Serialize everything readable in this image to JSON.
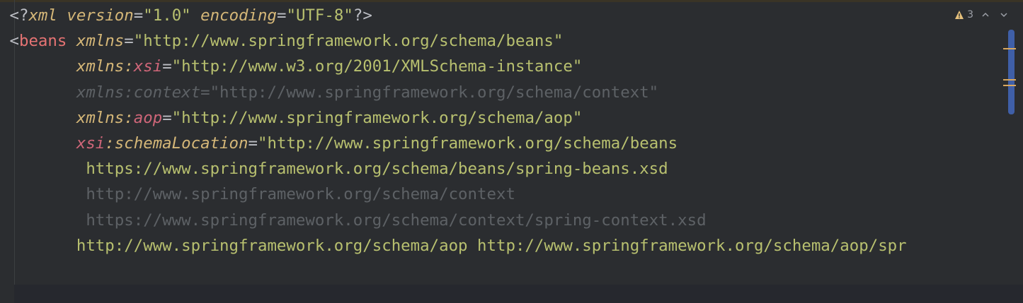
{
  "editor": {
    "lines": [
      {
        "dim": false,
        "indent": "",
        "tokens": [
          {
            "c": "t-punct",
            "t": "<?"
          },
          {
            "c": "t-attr",
            "t": "xml"
          },
          {
            "c": "t-punct",
            "t": " "
          },
          {
            "c": "t-attr",
            "t": "version"
          },
          {
            "c": "t-eq",
            "t": "="
          },
          {
            "c": "t-str",
            "t": "\"1.0\""
          },
          {
            "c": "t-punct",
            "t": " "
          },
          {
            "c": "t-attr",
            "t": "encoding"
          },
          {
            "c": "t-eq",
            "t": "="
          },
          {
            "c": "t-str",
            "t": "\"UTF-8\""
          },
          {
            "c": "t-punct",
            "t": "?>"
          }
        ]
      },
      {
        "dim": false,
        "indent": "",
        "tokens": [
          {
            "c": "t-punct",
            "t": "<"
          },
          {
            "c": "t-kw-tag",
            "t": "beans"
          },
          {
            "c": "t-punct",
            "t": " "
          },
          {
            "c": "t-attr",
            "t": "xmlns"
          },
          {
            "c": "t-eq",
            "t": "="
          },
          {
            "c": "t-str",
            "t": "\"http://www.springframework.org/schema/beans\""
          }
        ]
      },
      {
        "dim": false,
        "indent": "       ",
        "tokens": [
          {
            "c": "t-attr",
            "t": "xmlns:"
          },
          {
            "c": "t-xsi",
            "t": "xsi"
          },
          {
            "c": "t-eq",
            "t": "="
          },
          {
            "c": "t-str",
            "t": "\"http://www.w3.org/2001/XMLSchema-instance\""
          }
        ]
      },
      {
        "dim": true,
        "indent": "       ",
        "tokens": [
          {
            "c": "t-attr",
            "t": "xmlns:context"
          },
          {
            "c": "t-eq",
            "t": "="
          },
          {
            "c": "t-str",
            "t": "\"http://www.springframework.org/schema/context\""
          }
        ]
      },
      {
        "dim": false,
        "indent": "       ",
        "tokens": [
          {
            "c": "t-attr",
            "t": "xmlns:"
          },
          {
            "c": "t-aop",
            "t": "aop"
          },
          {
            "c": "t-eq",
            "t": "="
          },
          {
            "c": "t-str",
            "t": "\"http://www.springframework.org/schema/aop\""
          }
        ]
      },
      {
        "dim": false,
        "indent": "       ",
        "tokens": [
          {
            "c": "t-xsi",
            "t": "xsi"
          },
          {
            "c": "t-attr",
            "t": ":schemaLocation"
          },
          {
            "c": "t-eq",
            "t": "="
          },
          {
            "c": "t-str",
            "t": "\"http://www.springframework.org/schema/beans"
          }
        ]
      },
      {
        "dim": false,
        "indent": "        ",
        "tokens": [
          {
            "c": "t-str",
            "t": "https://www.springframework.org/schema/beans/spring-beans.xsd"
          }
        ]
      },
      {
        "dim": true,
        "indent": "        ",
        "tokens": [
          {
            "c": "t-str",
            "t": "http://www.springframework.org/schema/context"
          }
        ]
      },
      {
        "dim": true,
        "indent": "        ",
        "tokens": [
          {
            "c": "t-str",
            "t": "https://www.springframework.org/schema/context/spring-context.xsd"
          }
        ]
      },
      {
        "dim": false,
        "indent": "       ",
        "tokens": [
          {
            "c": "t-str",
            "t": "http://www.springframework.org/schema/aop http://www.springframework.org/schema/aop/spr"
          }
        ]
      }
    ]
  },
  "inspection": {
    "warning_count": "3",
    "warning_icon": "warning-triangle-icon",
    "up_icon": "chevron-up-icon",
    "down_icon": "chevron-down-icon",
    "warning_color": "#e5c07b"
  }
}
